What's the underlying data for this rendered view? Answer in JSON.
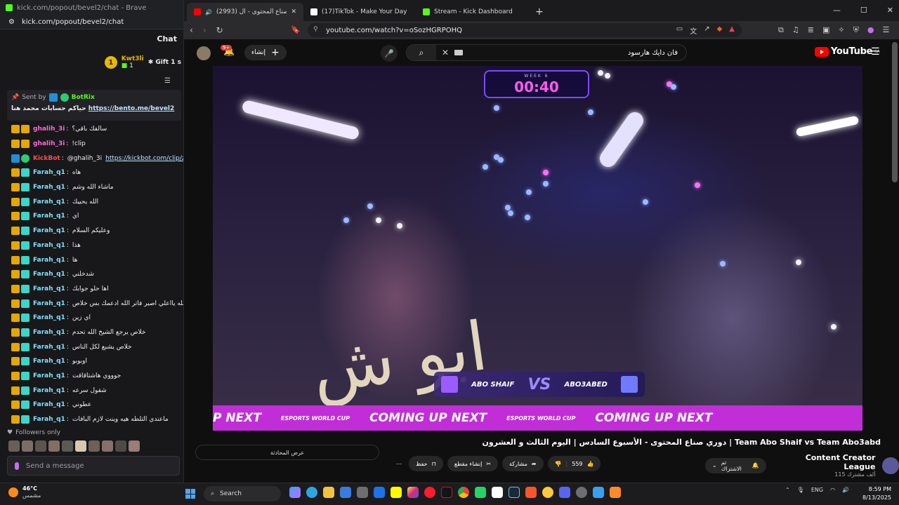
{
  "kick": {
    "window_title": "kick.com/popout/bevel2/chat - Brave",
    "url": "kick.com/popout/bevel2/chat",
    "header": "Chat",
    "top_gifter": {
      "rank": "1",
      "name": "Kwt3li",
      "count": "1",
      "gift_label": "Gift 1 s"
    },
    "pinned": {
      "sent_by_label": "Sent by",
      "sender": "BotRix",
      "message": "حياكم حسابات محمد هنا",
      "link": "https://bento.me/bevel2"
    },
    "messages": [
      {
        "user": "ghalih_3i",
        "text": "سالفك باقي؟",
        "color": "pink"
      },
      {
        "user": "ghalih_3i",
        "text": "!clip",
        "color": "pink"
      },
      {
        "user": "KickBot",
        "text": "@ghalih_3i",
        "link": "https://kickbot.com/clip/zufglfw",
        "color": "red"
      },
      {
        "user": "Farah_q1",
        "text": "هاه",
        "color": "cyan"
      },
      {
        "user": "Farah_q1",
        "text": "ماشاء الله وشم",
        "color": "cyan"
      },
      {
        "user": "Farah_q1",
        "text": "الله يحييك",
        "color": "cyan"
      },
      {
        "user": "Farah_q1",
        "text": "اي",
        "color": "cyan"
      },
      {
        "user": "Farah_q1",
        "text": "وعليكم السلام",
        "color": "cyan"
      },
      {
        "user": "Farah_q1",
        "text": "هذا",
        "color": "cyan"
      },
      {
        "user": "Farah_q1",
        "text": "ها",
        "color": "cyan"
      },
      {
        "user": "Farah_q1",
        "text": "شدخلني",
        "color": "cyan"
      },
      {
        "user": "Farah_q1",
        "text": "اها حلو جوابك",
        "color": "cyan"
      },
      {
        "user": "Farah_q1",
        "text": "كنت بتبدع الله يااعلي اصير فاتر الله ادعمك بس خلاص",
        "color": "cyan"
      },
      {
        "user": "Farah_q1",
        "text": "اي زين",
        "color": "cyan"
      },
      {
        "user": "Farah_q1",
        "text": "خلاص يرجع الشيخ الله تحدم",
        "color": "cyan"
      },
      {
        "user": "Farah_q1",
        "text": "خلاص يشبع لكل الناس",
        "color": "cyan"
      },
      {
        "user": "Farah_q1",
        "text": "اوبوبو",
        "color": "cyan"
      },
      {
        "user": "Farah_q1",
        "text": "جوووي هاشتاقاقت",
        "color": "cyan"
      },
      {
        "user": "Farah_q1",
        "text": "شقول سرعه",
        "color": "cyan"
      },
      {
        "user": "Farah_q1",
        "text": "عطوني",
        "color": "cyan"
      },
      {
        "user": "Farah_q1",
        "text": "ماعندي التلطه هيه وينت لازم البافات",
        "color": "cyan"
      }
    ],
    "followers_only": "Followers only",
    "input_placeholder": "Send a message"
  },
  "browser": {
    "tabs": [
      {
        "label": "(2993) دوري صناع المحتوى - ال",
        "active": true,
        "icon_color": "#ff0000"
      },
      {
        "label": "(17)TikTok - Make Your Day",
        "active": false,
        "icon_color": "#ffffff"
      },
      {
        "label": "Stream - Kick Dashboard",
        "active": false,
        "icon_color": "#53fc18"
      }
    ],
    "new_tab": "+",
    "url": "youtube.com/watch?v=oSozHGRPOHQ"
  },
  "youtube": {
    "notifications": "9+",
    "create_label": "إنشاء",
    "search_query": "فان دايك هارسود",
    "logo_text": "YouTube",
    "logo_region": "SA",
    "video": {
      "timer_week": "WEEK 6",
      "timer": "00:40",
      "team_left": "ABO SHAIF",
      "vs": "VS",
      "team_right": "ABO3ABED",
      "shoulder_text": "ابو ش",
      "ticker": [
        "P NEXT",
        "ESPORTS WORLD CUP",
        "COMING UP NEXT",
        "ESPORTS WORLD CUP",
        "COMING UP NEXT"
      ]
    },
    "title": "دوري صناع المحتوى - الأسبوع السادس | اليوم الثالث و العشرون | Team Abo Shaif vs Team Abo3abd",
    "chat_replay": "عرض المحادثة",
    "actions": {
      "more": "⋯",
      "save": "حفظ",
      "clip": "إنشاء مقطع",
      "share": "مشاركة",
      "likes": "559"
    },
    "channel": {
      "name": "Content Creator League",
      "subs": "115 ألف مشترك",
      "subscribed": "تم الاشتراك"
    }
  },
  "taskbar": {
    "temp": "46°C",
    "weather_desc": "مشمس",
    "search": "Search",
    "lang": "ENG",
    "time": "8:59 PM",
    "date": "8/13/2025"
  }
}
